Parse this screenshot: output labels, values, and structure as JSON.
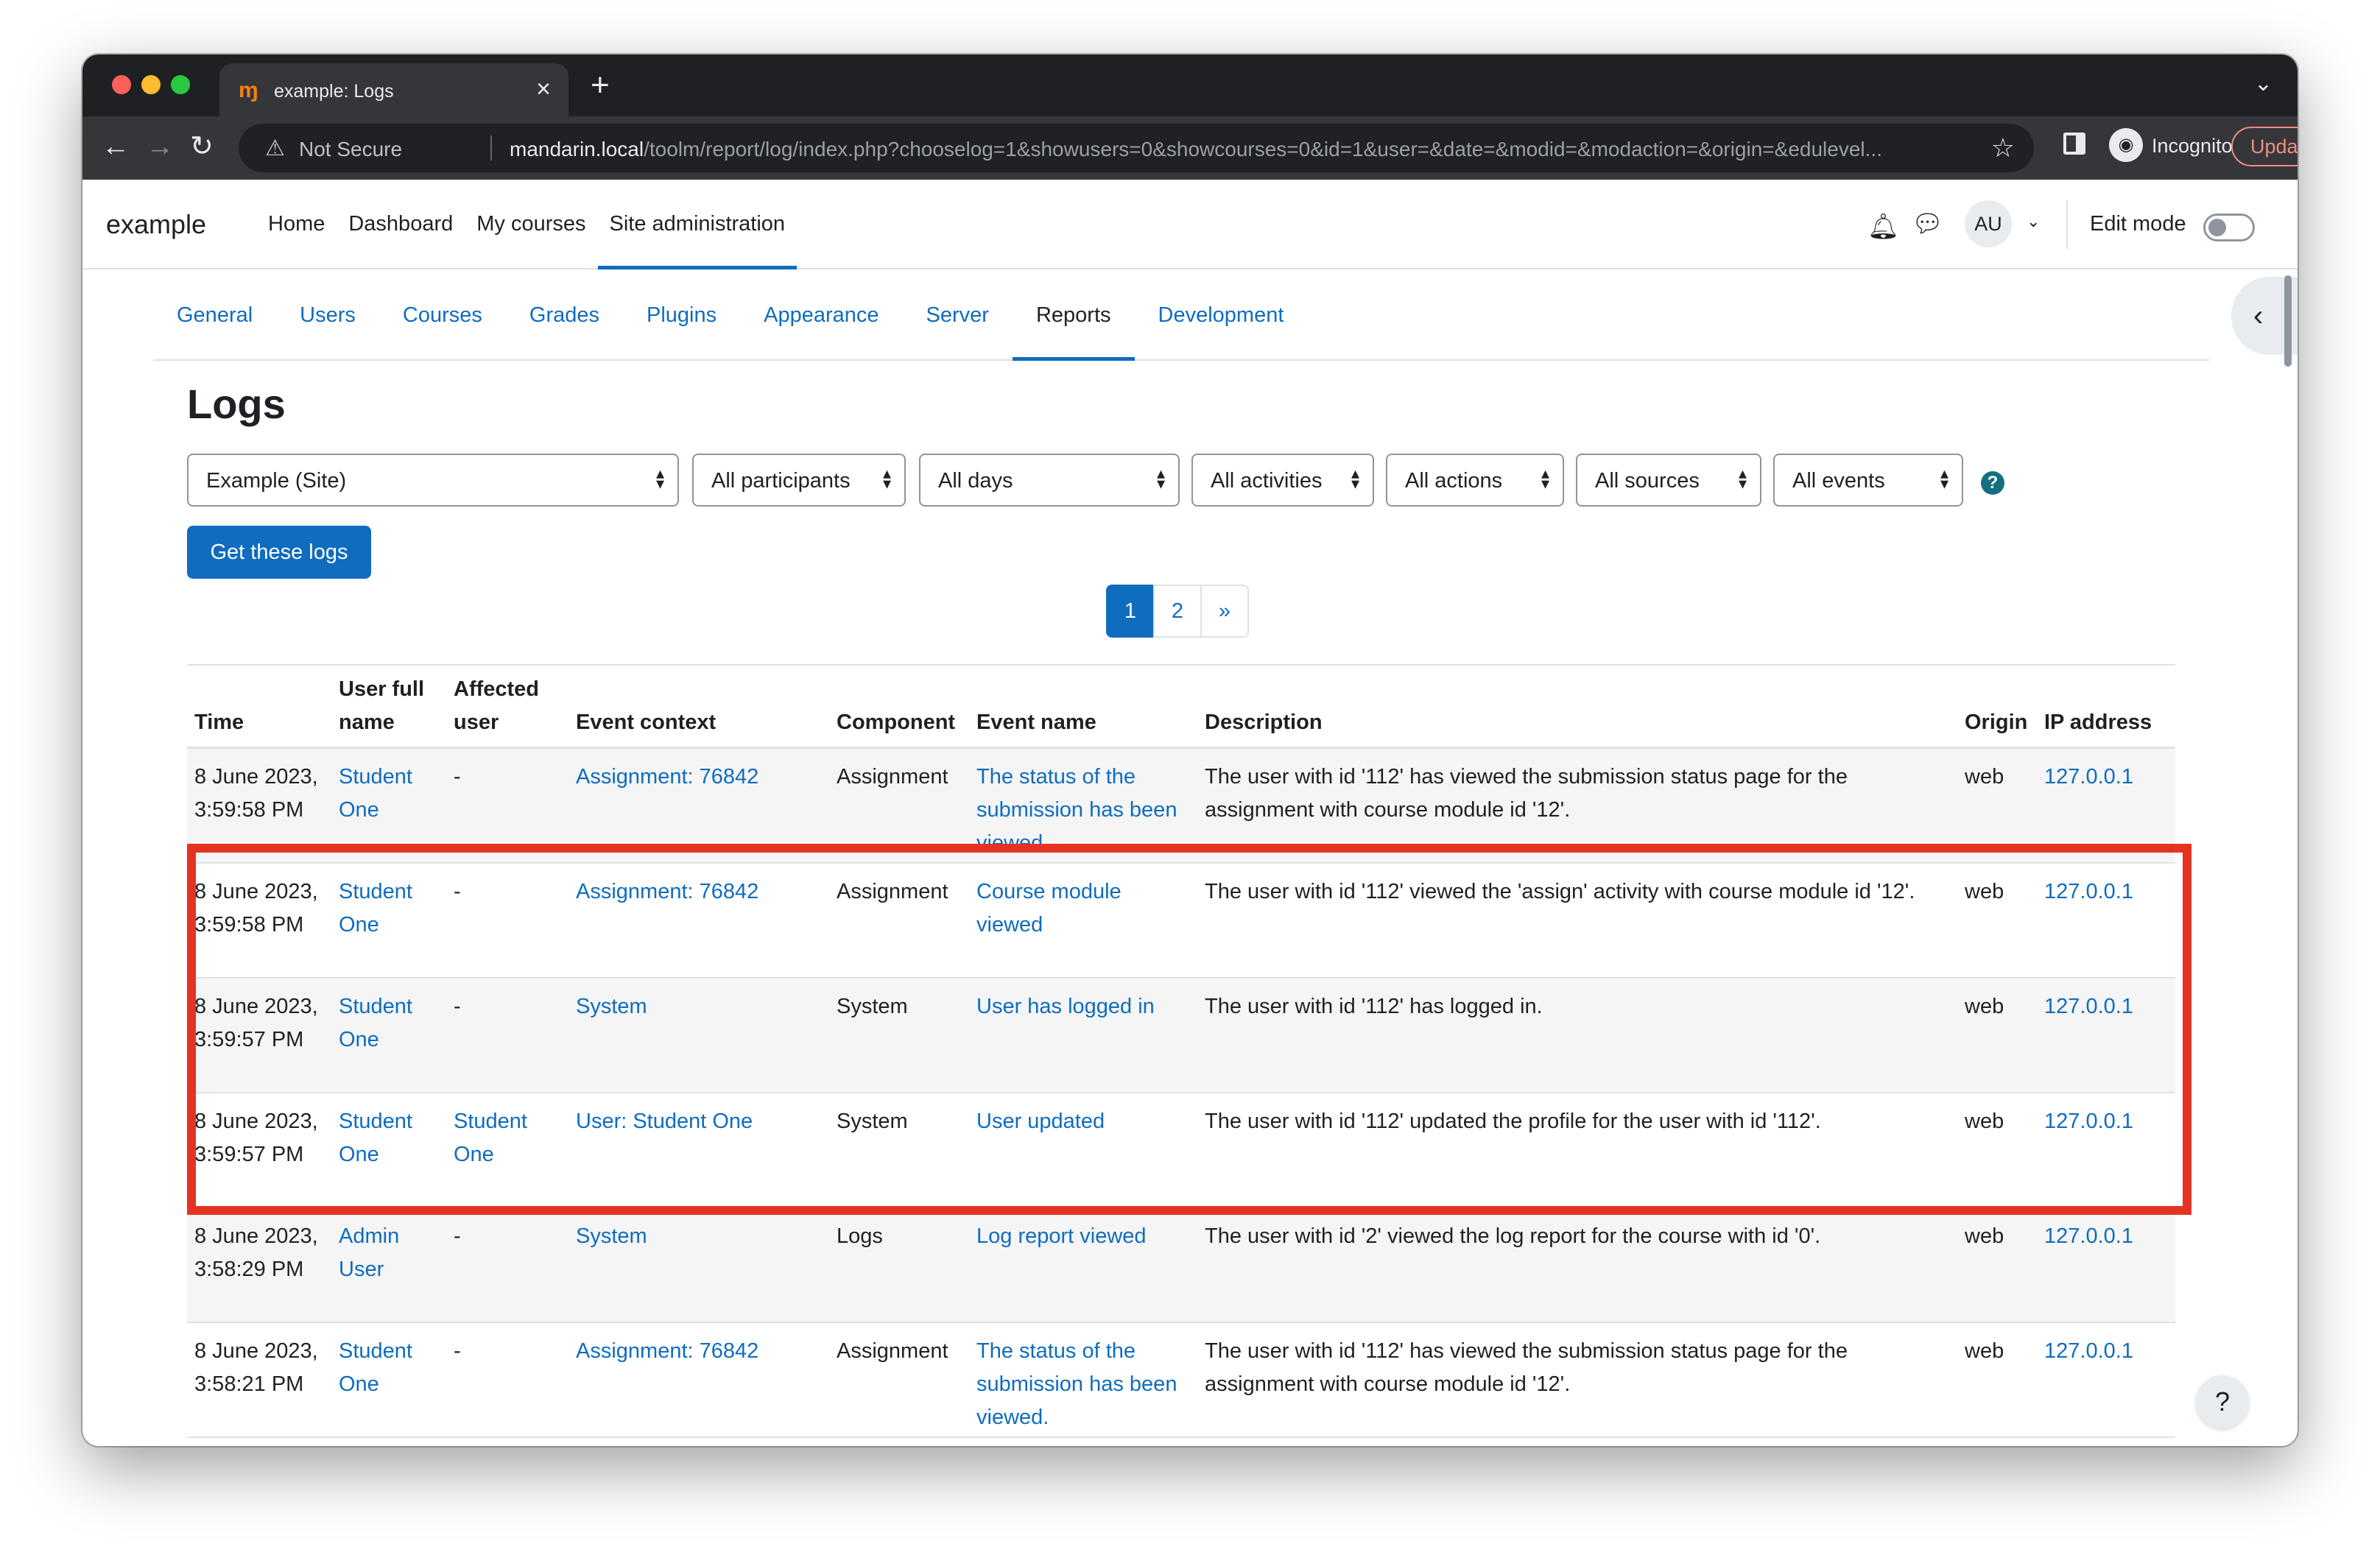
{
  "browser": {
    "tab_title": "example: Logs",
    "tab_favicon": "moodle-icon",
    "close_glyph": "×",
    "newtab_glyph": "+",
    "tabsearch_glyph": "⌄",
    "not_secure": "Not Secure",
    "url_host": "mandarin.local",
    "url_path": "/toolm/report/log/index.php?chooselog=1&showusers=0&showcourses=0&id=1&user=&date=&modid=&modaction=&origin=&edulevel...",
    "incognito_label": "Incognito",
    "update_label": "Update"
  },
  "navbar": {
    "brand": "example",
    "items": [
      {
        "label": "Home"
      },
      {
        "label": "Dashboard"
      },
      {
        "label": "My courses"
      },
      {
        "label": "Site administration",
        "active": true
      }
    ],
    "avatar_initials": "AU",
    "edit_mode_label": "Edit mode"
  },
  "secondary_nav": {
    "items": [
      {
        "label": "General"
      },
      {
        "label": "Users"
      },
      {
        "label": "Courses"
      },
      {
        "label": "Grades"
      },
      {
        "label": "Plugins"
      },
      {
        "label": "Appearance"
      },
      {
        "label": "Server"
      },
      {
        "label": "Reports",
        "active": true
      },
      {
        "label": "Development"
      }
    ]
  },
  "page": {
    "title": "Logs"
  },
  "filters": [
    {
      "value": "Example (Site)"
    },
    {
      "value": "All participants"
    },
    {
      "value": "All days"
    },
    {
      "value": "All activities"
    },
    {
      "value": "All actions"
    },
    {
      "value": "All sources"
    },
    {
      "value": "All events"
    }
  ],
  "get_logs_label": "Get these logs",
  "pagination": {
    "pages": [
      "1",
      "2",
      "»"
    ],
    "current": "1"
  },
  "table": {
    "headers": [
      "Time",
      "User full name",
      "Affected user",
      "Event context",
      "Component",
      "Event name",
      "Description",
      "Origin",
      "IP address"
    ],
    "rows": [
      {
        "time": "8 June 2023, 3:59:58 PM",
        "user": "Student One",
        "affected": "-",
        "context": "Assignment: 76842",
        "component": "Assignment",
        "event": "The status of the submission has been viewed.",
        "description": "The user with id '112' has viewed the submission status page for the assignment with course module id '12'.",
        "origin": "web",
        "ip": "127.0.0.1"
      },
      {
        "time": "8 June 2023, 3:59:58 PM",
        "user": "Student One",
        "affected": "-",
        "context": "Assignment: 76842",
        "component": "Assignment",
        "event": "Course module viewed",
        "description": "The user with id '112' viewed the 'assign' activity with course module id '12'.",
        "origin": "web",
        "ip": "127.0.0.1"
      },
      {
        "time": "8 June 2023, 3:59:57 PM",
        "user": "Student One",
        "affected": "-",
        "context": "System",
        "component": "System",
        "event": "User has logged in",
        "description": "The user with id '112' has logged in.",
        "origin": "web",
        "ip": "127.0.0.1"
      },
      {
        "time": "8 June 2023, 3:59:57 PM",
        "user": "Student One",
        "affected": "Student One",
        "context": "User: Student One",
        "component": "System",
        "event": "User updated",
        "description": "The user with id '112' updated the profile for the user with id '112'.",
        "origin": "web",
        "ip": "127.0.0.1"
      },
      {
        "time": "8 June 2023, 3:58:29 PM",
        "user": "Admin User",
        "affected": "-",
        "context": "System",
        "component": "Logs",
        "event": "Log report viewed",
        "description": "The user with id '2' viewed the log report for the course with id '0'.",
        "origin": "web",
        "ip": "127.0.0.1"
      },
      {
        "time": "8 June 2023, 3:58:21 PM",
        "user": "Student One",
        "affected": "-",
        "context": "Assignment: 76842",
        "component": "Assignment",
        "event": "The status of the submission has been viewed.",
        "description": "The user with id '112' has viewed the submission status page for the assignment with course module id '12'.",
        "origin": "web",
        "ip": "127.0.0.1"
      }
    ]
  },
  "highlight_color": "#e53323",
  "accent_color": "#0f6cbf",
  "help_glyph": "?"
}
